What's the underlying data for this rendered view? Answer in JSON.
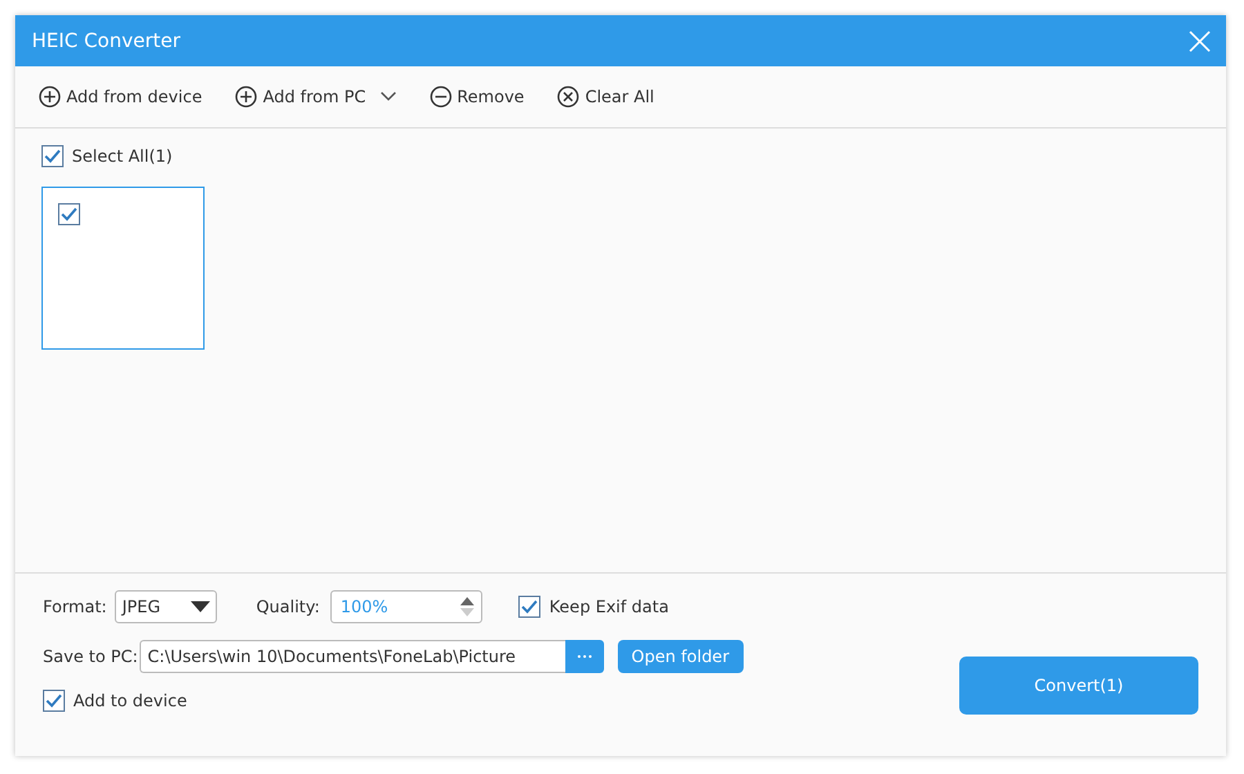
{
  "window": {
    "title": "HEIC Converter"
  },
  "toolbar": [
    {
      "label": "Add from device",
      "kind": "add",
      "dropdown": false
    },
    {
      "label": "Add from PC",
      "kind": "add",
      "dropdown": true
    },
    {
      "label": "Remove",
      "kind": "remove",
      "dropdown": false
    },
    {
      "label": "Clear All",
      "kind": "clear",
      "dropdown": false
    }
  ],
  "select_all": {
    "label": "Select All(1)",
    "checked": true
  },
  "thumbnails": [
    {
      "checked": true
    }
  ],
  "format": {
    "label": "Format:",
    "value": "JPEG"
  },
  "quality": {
    "label": "Quality:",
    "value": "100%"
  },
  "keep_exif": {
    "label": "Keep Exif data",
    "checked": true
  },
  "save_to_pc": {
    "label": "Save to PC:",
    "value": "C:\\Users\\win 10\\Documents\\FoneLab\\Picture"
  },
  "open_folder": "Open folder",
  "add_to_device": {
    "label": "Add to device",
    "checked": true
  },
  "convert": "Convert(1)"
}
